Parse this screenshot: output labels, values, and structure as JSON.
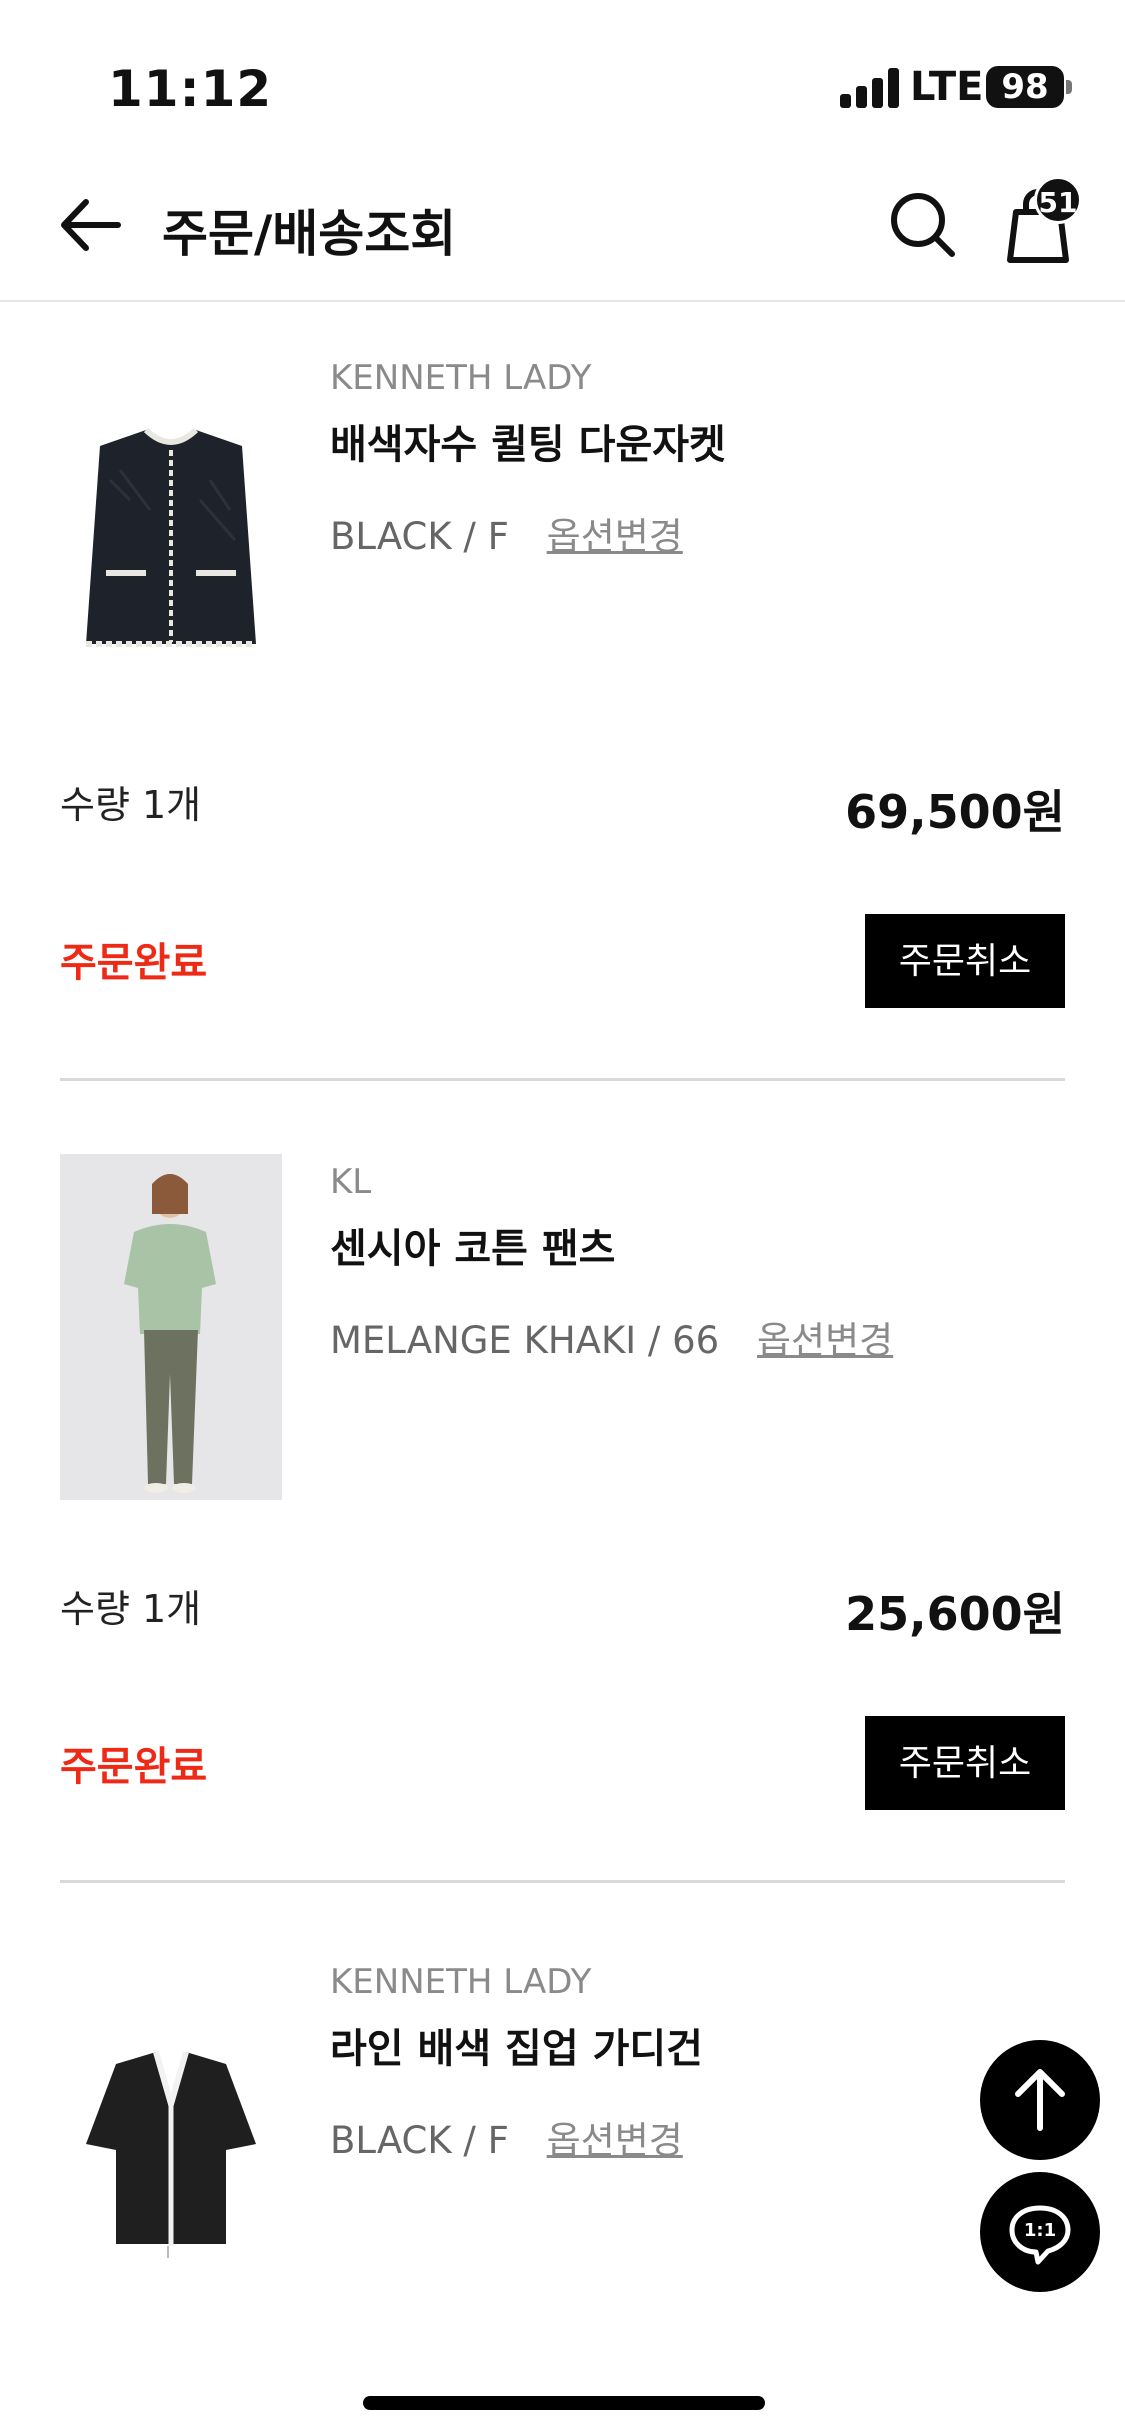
{
  "status_bar": {
    "time": "11:12",
    "network": "LTE",
    "battery": "98"
  },
  "header": {
    "title": "주문/배송조회",
    "cart_count": "51",
    "icons": [
      "back-arrow-icon",
      "search-icon",
      "shopping-bag-icon"
    ]
  },
  "orders": [
    {
      "brand": "KENNETH LADY",
      "name": "배색자수 퀼팅 다운자켓",
      "option": "BLACK / F",
      "option_change": "옵션변경",
      "quantity": "수량 1개",
      "price": "69,500원",
      "status": "주문완료",
      "cancel_label": "주문취소"
    },
    {
      "brand": "KL",
      "name": "센시아 코튼 팬츠",
      "option": "MELANGE KHAKI / 66",
      "option_change": "옵션변경",
      "quantity": "수량 1개",
      "price": "25,600원",
      "status": "주문완료",
      "cancel_label": "주문취소"
    },
    {
      "brand": "KENNETH LADY",
      "name": "라인 배색 집업 가디건",
      "option": "BLACK / F",
      "option_change": "옵션변경"
    }
  ],
  "floating": {
    "scroll_top_icon": "arrow-up-icon",
    "chat_icon": "chat-1to1-icon",
    "chat_label": "1:1"
  },
  "colors": {
    "status_red": "#ee2a17",
    "button_black": "#000000",
    "muted_text": "#8a8a8a"
  }
}
